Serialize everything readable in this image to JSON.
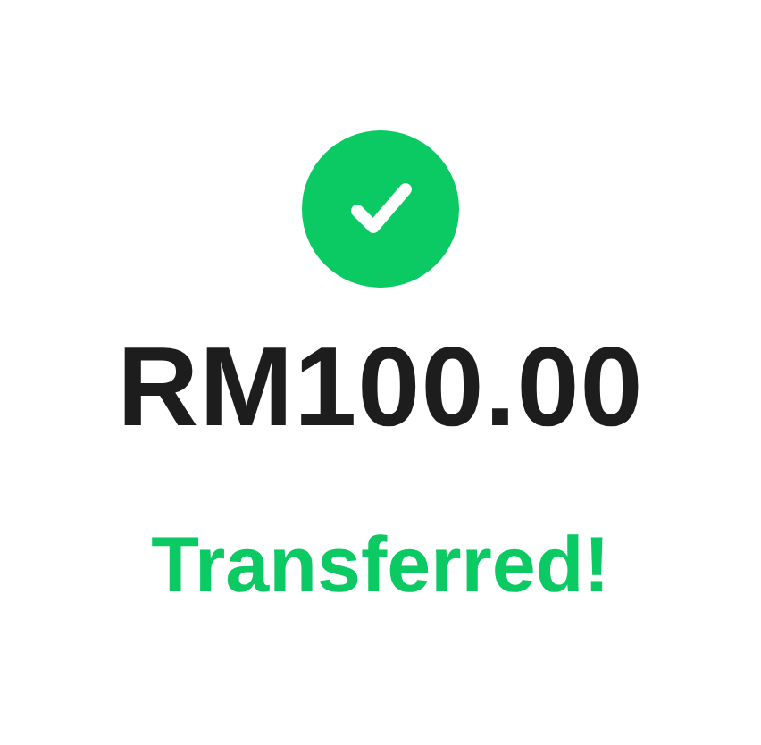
{
  "amount": "RM100.00",
  "status": {
    "kind": "success",
    "text": "Transferred!"
  }
}
